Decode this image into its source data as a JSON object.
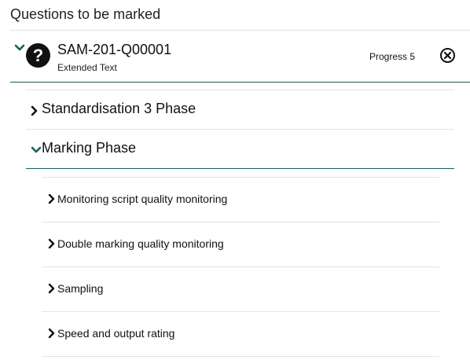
{
  "panel": {
    "title": "Questions to be marked"
  },
  "question": {
    "code": "SAM-201-Q00001",
    "type": "Extended Text",
    "progress": "Progress 5",
    "help_glyph": "?",
    "icons": {
      "expand": "chevron-down-icon",
      "help": "question-circle-icon",
      "close": "close-circle-icon"
    }
  },
  "phases": [
    {
      "label": "Standardisation 3 Phase",
      "expanded": false
    },
    {
      "label": "Marking Phase",
      "expanded": true
    }
  ],
  "marking_items": [
    {
      "label": "Monitoring script quality monitoring"
    },
    {
      "label": "Double marking quality monitoring"
    },
    {
      "label": "Sampling"
    },
    {
      "label": "Speed and output rating"
    }
  ],
  "colors": {
    "accent": "#1d5c5c",
    "divider": "#e3e3e3",
    "text": "#111111"
  }
}
